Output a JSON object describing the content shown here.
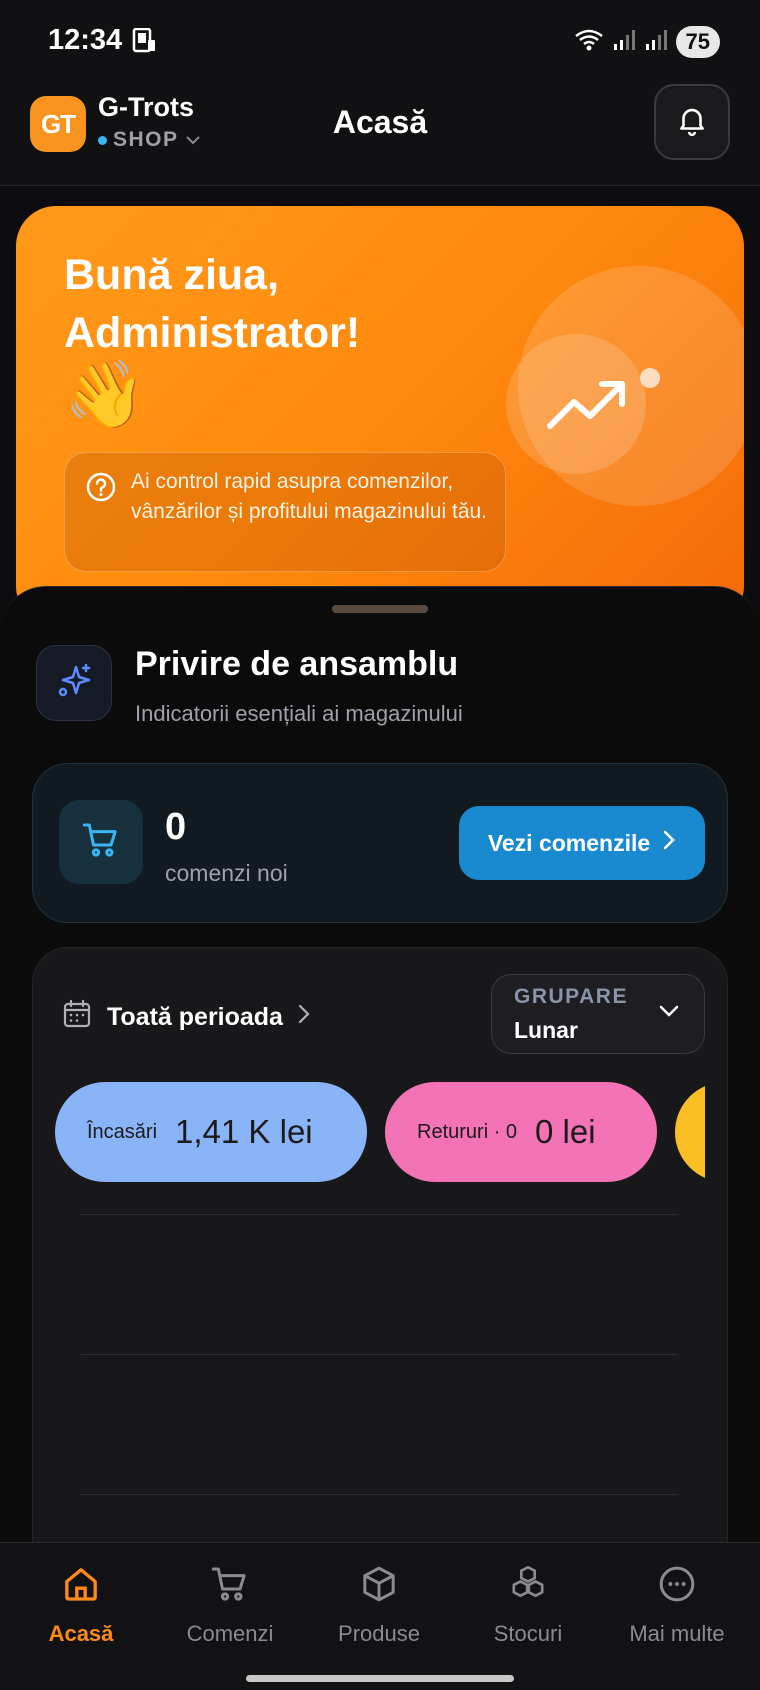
{
  "status_bar": {
    "time": "12:34",
    "battery": "75",
    "icons": [
      "phone-icon",
      "wifi-icon",
      "signal-icon",
      "signal-icon"
    ]
  },
  "header": {
    "logo_text": "GT",
    "store_name": "G-Trots",
    "store_type": "SHOP",
    "title": "Acasă",
    "notifications_icon": "bell-icon"
  },
  "hero": {
    "greeting": "Bună ziua, Administrator!",
    "wave_emoji": "👋",
    "info_text": "Ai control rapid asupra comenzilor, vânzărilor și profitului magazinului tău.",
    "colors": {
      "start": "#ff9a1a",
      "end": "#f46a0a"
    }
  },
  "overview": {
    "title": "Privire de ansamblu",
    "subtitle": "Indicatorii esențiali ai magazinului"
  },
  "orders": {
    "count": "0",
    "label": "comenzi noi",
    "button_label": "Vezi comenzile"
  },
  "stats": {
    "period_label": "Toată perioada",
    "grouping_label": "GRUPARE",
    "grouping_value": "Lunar",
    "pills": [
      {
        "label": "Încasări",
        "value": "1,41 K lei",
        "color": "#8ab4f8"
      },
      {
        "label": "Retururi · 0",
        "value": "0 lei",
        "color": "#f472b6"
      }
    ],
    "third_pill_color": "#fbbf24"
  },
  "nav": {
    "items": [
      {
        "label": "Acasă",
        "icon": "home-icon",
        "active": true
      },
      {
        "label": "Comenzi",
        "icon": "cart-icon",
        "active": false
      },
      {
        "label": "Produse",
        "icon": "box-icon",
        "active": false
      },
      {
        "label": "Stocuri",
        "icon": "stacked-boxes-icon",
        "active": false
      },
      {
        "label": "Mai multe",
        "icon": "more-icon",
        "active": false
      }
    ],
    "active_color": "#ff8a1a"
  }
}
